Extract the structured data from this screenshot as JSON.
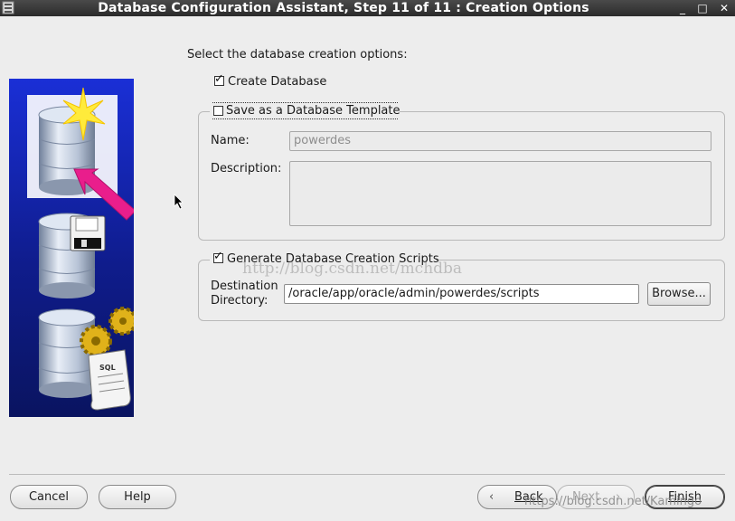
{
  "window": {
    "title": "Database Configuration Assistant, Step 11 of 11 : Creation Options",
    "minimize": "_",
    "maximize": "□",
    "close": "✕"
  },
  "prompt": "Select the database creation options:",
  "create_database": {
    "label": "Create Database",
    "checked": true
  },
  "save_template": {
    "label": "Save as a Database Template",
    "checked": false,
    "name_label": "Name:",
    "name_value": "powerdes",
    "description_label": "Description:",
    "description_value": ""
  },
  "generate_scripts": {
    "label": "Generate Database Creation Scripts",
    "checked": true,
    "dest_label_line1": "Destination",
    "dest_label_line2": "Directory:",
    "dest_value": "/oracle/app/oracle/admin/powerdes/scripts",
    "browse_label": "Browse..."
  },
  "watermark_text": "http://blog.csdn.net/mchdba",
  "watermark_text_bottom": "https://blog.csdn.net/Kamingo",
  "footer": {
    "cancel": "Cancel",
    "help": "Help",
    "back": "Back",
    "next": "Next",
    "finish": "Finish"
  },
  "icons": {
    "back": "chevron-left-icon",
    "next": "chevron-right-icon",
    "cursor": "mouse-pointer-icon"
  }
}
